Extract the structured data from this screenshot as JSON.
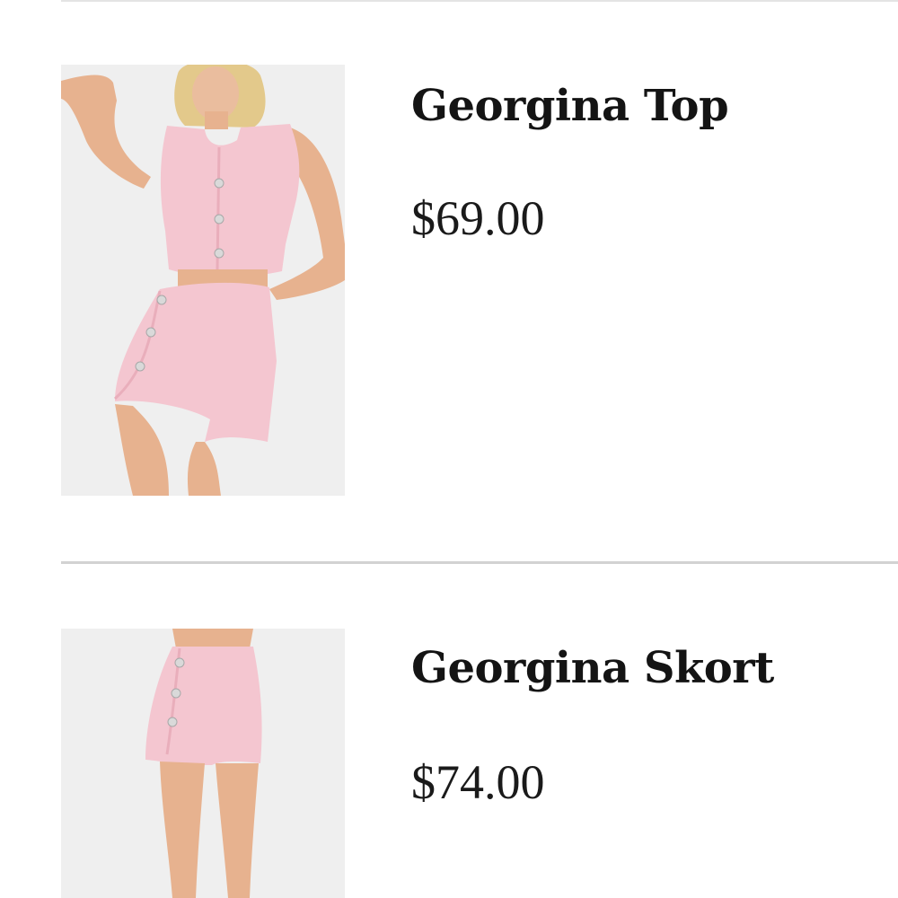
{
  "products": [
    {
      "name": "Georgina Top",
      "price": "$69.00",
      "image": "pink jacquard vest and skort set on model"
    },
    {
      "name": "Georgina Skort",
      "price": "$74.00",
      "image": "pink jacquard skort on model"
    }
  ],
  "colors": {
    "fabric": "#f4c6d0",
    "fabric_shade": "#e9aebb",
    "skin": "#e7b28f",
    "hair": "#e3c98b",
    "button": "#d9d9d9",
    "divider": "#d2d2d2"
  }
}
